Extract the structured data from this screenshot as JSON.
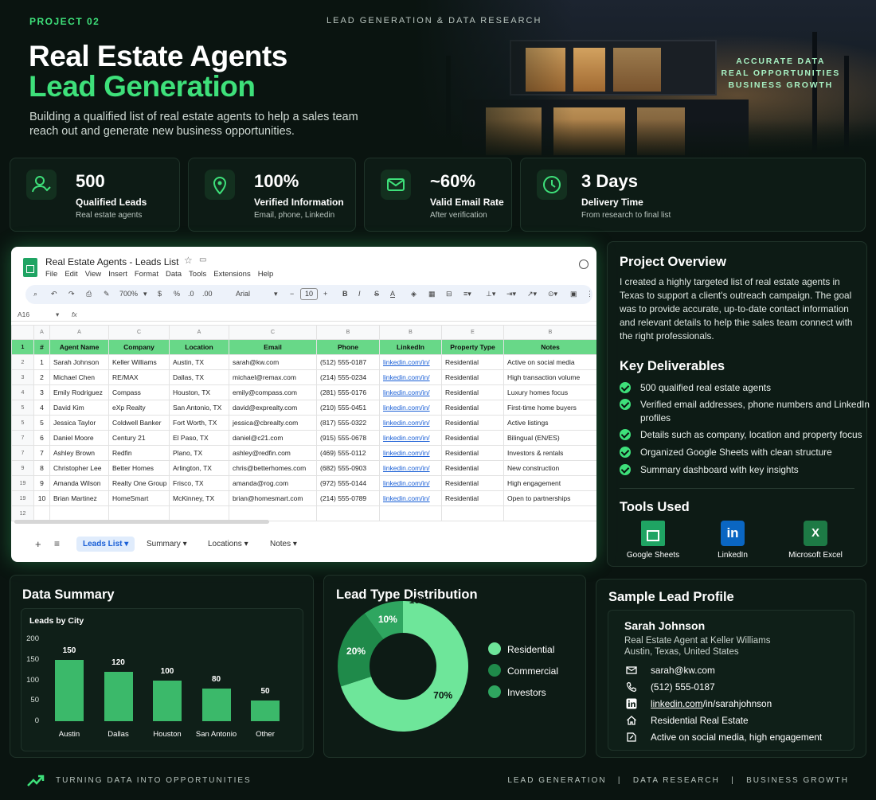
{
  "header": {
    "project_tag": "PROJECT 02",
    "category": "LEAD GENERATION & DATA RESEARCH",
    "title_line1": "Real Estate Agents",
    "title_line2": "Lead Generation",
    "subtitle": "Building a qualified list of real estate agents to help a sales team reach out and generate new business opportunities.",
    "taglines": [
      "ACCURATE DATA",
      "REAL OPPORTUNITIES",
      "BUSINESS GROWTH"
    ]
  },
  "stats": [
    {
      "icon": "user-check-icon",
      "value": "500",
      "label": "Qualified Leads",
      "sub": "Real estate agents"
    },
    {
      "icon": "map-pin-icon",
      "value": "100%",
      "label": "Verified Information",
      "sub": "Email, phone, Linkedin"
    },
    {
      "icon": "mail-icon",
      "value": "~60%",
      "label": "Valid Email Rate",
      "sub": "After verification"
    },
    {
      "icon": "clock-icon",
      "value": "3 Days",
      "label": "Delivery Time",
      "sub": "From research to final list"
    }
  ],
  "sheet": {
    "title": "Real Estate Agents - Leads List",
    "menu": [
      "File",
      "Edit",
      "View",
      "Insert",
      "Format",
      "Data",
      "Tools",
      "Extensions",
      "Help"
    ],
    "zoom": "700%",
    "font": "Arial",
    "font_size": "10",
    "cell_ref": "A16",
    "col_letters": [
      "A",
      "A",
      "C",
      "A",
      "C",
      "B",
      "B",
      "E",
      "B"
    ],
    "headers": [
      "#",
      "Agent Name",
      "Company",
      "Location",
      "Email",
      "Phone",
      "LinkedIn",
      "Property Type",
      "Notes"
    ],
    "row_nums": [
      "2",
      "3",
      "4",
      "5",
      "5",
      "7",
      "7",
      "9",
      "19",
      "19"
    ],
    "rows": [
      [
        "1",
        "Sarah Johnson",
        "Keller Williams",
        "Austin, TX",
        "sarah@kw.com",
        "(512) 555-0187",
        "linkedin.com/in/",
        "Residential",
        "Active on social media"
      ],
      [
        "2",
        "Michael Chen",
        "RE/MAX",
        "Dallas, TX",
        "michael@remax.com",
        "(214) 555-0234",
        "linkedin.com/in/",
        "Residential",
        "High transaction volume"
      ],
      [
        "3",
        "Emily Rodriguez",
        "Compass",
        "Houston, TX",
        "emily@compass.com",
        "(281) 555-0176",
        "linkedin.com/in/",
        "Residential",
        "Luxury homes focus"
      ],
      [
        "4",
        "David Kim",
        "eXp Realty",
        "San Antonio, TX",
        "david@exprealty.com",
        "(210) 555-0451",
        "linkedin.com/in/",
        "Residential",
        "First-time home buyers"
      ],
      [
        "5",
        "Jessica Taylor",
        "Coldwell Banker",
        "Fort Worth, TX",
        "jessica@cbrealty.com",
        "(817) 555-0322",
        "linkedin.com/in/",
        "Residential",
        "Active listings"
      ],
      [
        "6",
        "Daniel Moore",
        "Century 21",
        "El Paso, TX",
        "daniel@c21.com",
        "(915) 555-0678",
        "linkedin.com/in/",
        "Residential",
        "Bilingual (EN/ES)"
      ],
      [
        "7",
        "Ashley Brown",
        "Redfin",
        "Plano, TX",
        "ashley@redfin.com",
        "(469) 555-0112",
        "linkedin.com/in/",
        "Residential",
        "Investors & rentals"
      ],
      [
        "8",
        "Christopher Lee",
        "Better Homes",
        "Arlington, TX",
        "chris@betterhomes.com",
        "(682) 555-0903",
        "linkedin.com/in/",
        "Residential",
        "New construction"
      ],
      [
        "9",
        "Amanda Wilson",
        "Realty One Group",
        "Frisco, TX",
        "amanda@rog.com",
        "(972) 555-0144",
        "linkedin.com/in/",
        "Residential",
        "High engagement"
      ],
      [
        "10",
        "Brian Martinez",
        "HomeSmart",
        "McKinney, TX",
        "brian@homesmart.com",
        "(214) 555-0789",
        "linkedin.com/in/",
        "Residential",
        "Open to partnerships"
      ]
    ],
    "tabs": [
      "Leads List",
      "Summary",
      "Locations",
      "Notes"
    ]
  },
  "overview": {
    "title": "Project Overview",
    "text": "I created a highly targeted list of real estate agents in Texas to support a client's outreach campaign. The goal was to provide accurate, up-to-date contact information and relevant details to help thie sales team connect with the right professionals.",
    "deliverables_title": "Key Deliverables",
    "deliverables": [
      "500 qualified real estate agents",
      "Verified email addresses, phone numbers and LinkedIn profiles",
      "Details such as company, location and property focus",
      "Organized Google Sheets with clean structure",
      "Summary dashboard with key insights"
    ],
    "tools_title": "Tools Used",
    "tools": [
      "Google Sheets",
      "LinkedIn",
      "Microsoft Excel"
    ]
  },
  "data_summary": {
    "title": "Data Summary",
    "chart_title": "Leads by City"
  },
  "chart_data": [
    {
      "type": "bar",
      "title": "Leads by City",
      "categories": [
        "Austin",
        "Dallas",
        "Houston",
        "San Antonio",
        "Other"
      ],
      "values": [
        150,
        120,
        100,
        80,
        50
      ],
      "yticks": [
        "200",
        "150",
        "100",
        "50",
        "0"
      ],
      "ylim": [
        0,
        200
      ],
      "grid": false,
      "bar_color": "#3bb96a"
    },
    {
      "type": "pie",
      "title": "Lead Type Distribution",
      "categories": [
        "Residential",
        "Commercial",
        "Investors"
      ],
      "values": [
        70,
        20,
        10
      ],
      "labels": [
        "70%",
        "20%",
        "10%",
        "10%"
      ],
      "colors": [
        "#6ee69a",
        "#1f8a4a",
        "#2fa660"
      ],
      "legend": "right"
    }
  ],
  "profile": {
    "title": "Sample Lead Profile",
    "name": "Sarah Johnson",
    "role": "Real Estate Agent at Keller Williams",
    "location": "Austin, Texas, United States",
    "email": "sarah@kw.com",
    "phone": "(512) 555-0187",
    "linkedin_prefix": "linkedin.com",
    "linkedin_path": "/in/sarahjohnson",
    "focus": "Residential Real Estate",
    "note": "Active on social media, high engagement"
  },
  "footer": {
    "left": "TURNING DATA INTO OPPORTUNITIES",
    "right": "LEAD GENERATION   |   DATA RESEARCH   |   BUSINESS GROWTH"
  },
  "colors": {
    "accent": "#3ee07a",
    "background": "#0a1410",
    "panel": "#0e1c16"
  }
}
